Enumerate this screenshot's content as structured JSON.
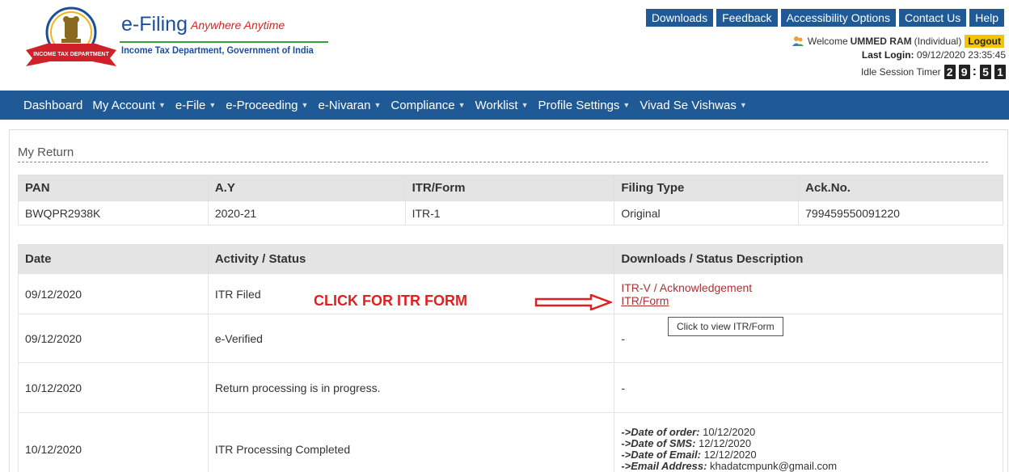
{
  "brand": {
    "title": "e-Filing",
    "tagline": "Anywhere Anytime",
    "subtitle": "Income Tax Department, Government of India",
    "emblem_ribbon": "INCOME TAX DEPARTMENT"
  },
  "top_nav": [
    "Downloads",
    "Feedback",
    "Accessibility Options",
    "Contact Us",
    "Help"
  ],
  "user": {
    "welcome_prefix": "Welcome",
    "name": "UMMED RAM",
    "type": "(Individual)",
    "logout_label": "Logout",
    "last_login_label": "Last Login:",
    "last_login_value": "09/12/2020 23:35:45",
    "idle_label": "Idle Session Timer",
    "timer_digits": [
      "2",
      "9",
      "5",
      "1"
    ]
  },
  "main_nav": [
    "Dashboard",
    "My Account",
    "e-File",
    "e-Proceeding",
    "e-Nivaran",
    "Compliance",
    "Worklist",
    "Profile Settings",
    "Vivad Se Vishwas"
  ],
  "section_title": "My Return",
  "return_table": {
    "headers": [
      "PAN",
      "A.Y",
      "ITR/Form",
      "Filing Type",
      "Ack.No."
    ],
    "row": [
      "BWQPR2938K",
      "2020-21",
      "ITR-1",
      "Original",
      "799459550091220"
    ]
  },
  "status_table": {
    "headers": [
      "Date",
      "Activity / Status",
      "Downloads / Status Description"
    ],
    "rows": [
      {
        "date": "09/12/2020",
        "activity": "ITR Filed",
        "link1": "ITR-V / Acknowledgement",
        "link2": "ITR/Form"
      },
      {
        "date": "09/12/2020",
        "activity": "e-Verified",
        "desc": "-"
      },
      {
        "date": "10/12/2020",
        "activity": "Return processing is in progress.",
        "desc": "-"
      },
      {
        "date": "10/12/2020",
        "activity": "ITR Processing Completed",
        "details": [
          {
            "label": "->Date of order:",
            "value": "10/12/2020"
          },
          {
            "label": "->Date of SMS:",
            "value": "12/12/2020"
          },
          {
            "label": "->Date of Email:",
            "value": "12/12/2020"
          },
          {
            "label": "->Email Address:",
            "value": "khadatcmpunk@gmail.com"
          }
        ]
      }
    ]
  },
  "annotation": "CLICK FOR ITR FORM",
  "tooltip": "Click to view ITR/Form",
  "colors": {
    "nav_blue": "#1f5a96",
    "logout_yellow": "#f5c400",
    "link_red": "#a33333",
    "annotation_red": "#e02020"
  }
}
